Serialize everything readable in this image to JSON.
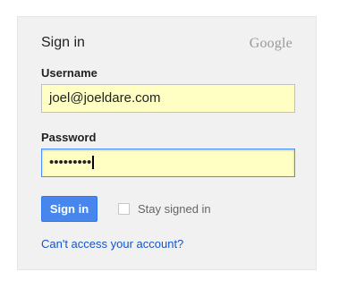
{
  "header": {
    "title": "Sign in",
    "brand": "Google"
  },
  "username": {
    "label": "Username",
    "value": "joel@joeldare.com"
  },
  "password": {
    "label": "Password",
    "masked_value": "•••••••••"
  },
  "actions": {
    "sign_in_label": "Sign in",
    "stay_signed_in_label": "Stay signed in",
    "stay_signed_in_checked": false,
    "help_link": "Can't access your account?"
  },
  "colors": {
    "button": "#4787ed",
    "field_autofill": "#ffffc4",
    "focus_border": "#4d90fe",
    "link": "#1155cc"
  }
}
